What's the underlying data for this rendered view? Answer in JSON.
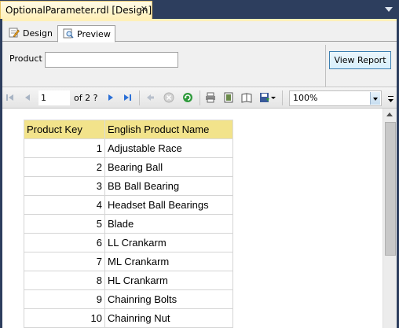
{
  "document_tab": {
    "title": "OptionalParameter.rdl [Design]",
    "close": "✕"
  },
  "view_tabs": [
    {
      "label": "Design",
      "icon": "design-icon"
    },
    {
      "label": "Preview",
      "icon": "preview-icon",
      "active": true
    }
  ],
  "parameters": {
    "product_label": "Product",
    "product_value": "",
    "view_report_label": "View Report"
  },
  "toolbar": {
    "page_current": "1",
    "page_of": "of 2 ?",
    "zoom": "100%"
  },
  "report": {
    "columns": [
      "Product Key",
      "English Product Name"
    ],
    "rows": [
      [
        "1",
        "Adjustable Race"
      ],
      [
        "2",
        "Bearing Ball"
      ],
      [
        "3",
        "BB Ball Bearing"
      ],
      [
        "4",
        "Headset Ball Bearings"
      ],
      [
        "5",
        "Blade"
      ],
      [
        "6",
        "LL Crankarm"
      ],
      [
        "7",
        "ML Crankarm"
      ],
      [
        "8",
        "HL Crankarm"
      ],
      [
        "9",
        "Chainring Bolts"
      ],
      [
        "10",
        "Chainring Nut"
      ]
    ]
  },
  "colors": {
    "ide_background": "#2d3e5e",
    "tab_active": "#fff0b8",
    "header_fill": "#f2e38b"
  }
}
